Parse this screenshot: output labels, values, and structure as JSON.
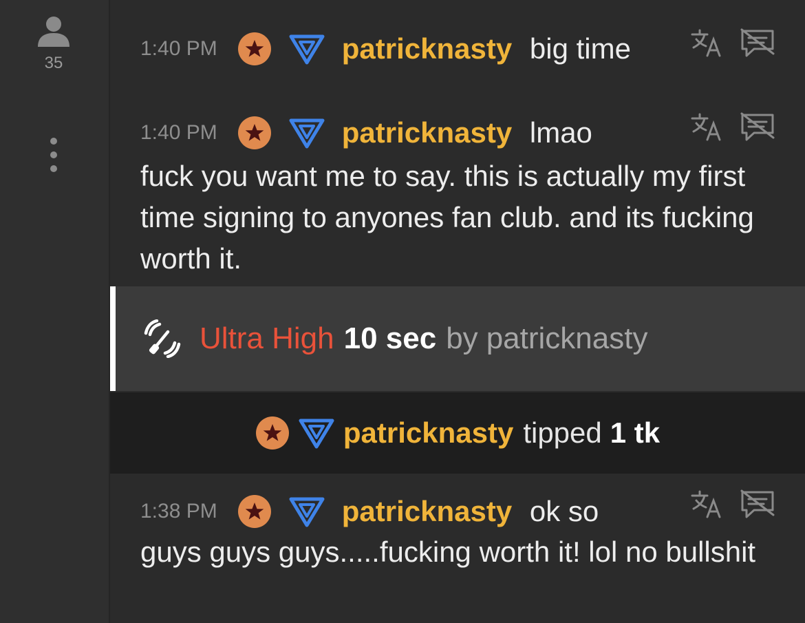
{
  "sidebar": {
    "user_count": "35"
  },
  "messages": [
    {
      "time": "1:40 PM",
      "username": "patricknasty",
      "text": "big time",
      "continuation": ""
    },
    {
      "time": "1:40 PM",
      "username": "patricknasty",
      "text": "lmao",
      "continuation": "fuck you want me to say. this is actually my first time signing to anyones fan club. and its fucking worth it."
    },
    {
      "time": "1:38 PM",
      "username": "patricknasty",
      "text": "ok so",
      "continuation": "guys guys guys.....fucking worth it! lol no bullshit"
    }
  ],
  "toy_event": {
    "level": "Ultra High",
    "duration": "10 sec",
    "by_label": "by",
    "username": "patricknasty"
  },
  "tip_event": {
    "username": "patricknasty",
    "action": "tipped",
    "amount": "1 tk"
  },
  "colors": {
    "username": "#f0b43a",
    "level": "#e9523a",
    "badge_orange": "#e08a4e",
    "badge_blue": "#3f83e8"
  },
  "icons": {
    "badge_star": "star-badge-icon",
    "badge_tier": "triangle-badge-icon",
    "translate": "translate-icon",
    "hide": "hide-message-icon"
  }
}
